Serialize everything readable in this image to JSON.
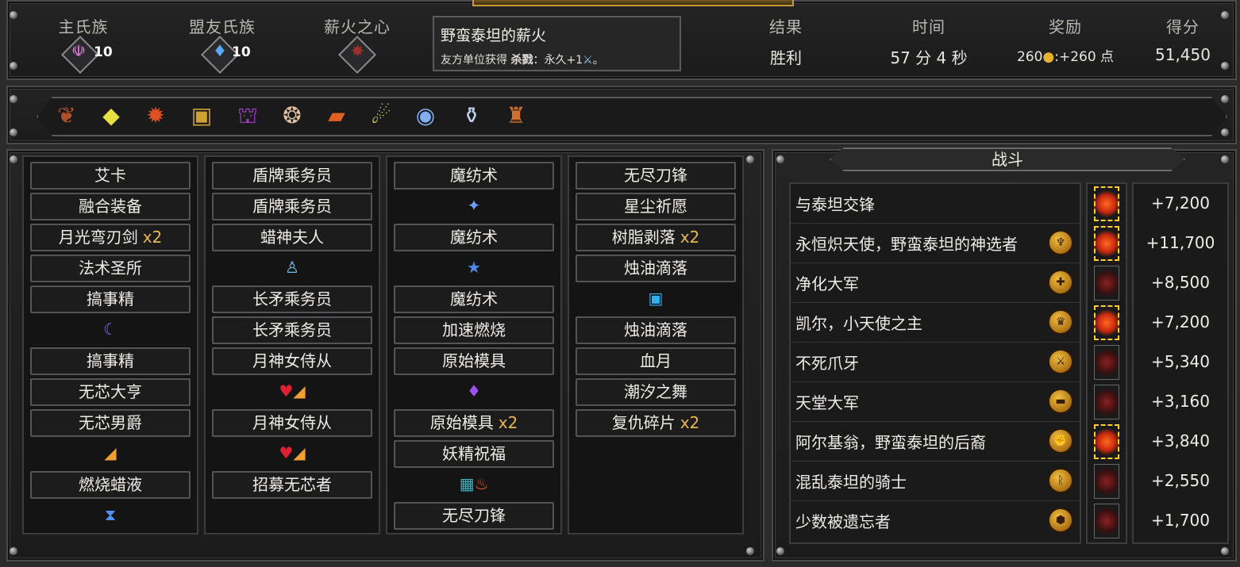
{
  "header": {
    "main_tribe_label": "主氏族",
    "main_tribe_value": "10",
    "ally_tribe_label": "盟友氏族",
    "ally_tribe_value": "10",
    "fire_heart_label": "薪火之心",
    "fire_title": "野蛮泰坦的薪火",
    "fire_desc_prefix": "友方单位获得",
    "fire_desc_keyword": "杀戮",
    "fire_desc_suffix": "：永久+1",
    "fire_desc_end": "。",
    "result_label": "结果",
    "result_value": "胜利",
    "time_label": "时间",
    "time_value": "57 分 4 秒",
    "reward_label": "奖励",
    "reward_gold": "260",
    "reward_points": ":+260 点",
    "score_label": "得分",
    "score_value": "51,450"
  },
  "artifacts": [
    "cannon-icon",
    "crystal-icon",
    "fire-spirit-icon",
    "golden-card-icon",
    "purple-table-icon",
    "dancer-icon",
    "fire-card-icon",
    "larva-icon",
    "frost-orb-icon",
    "vial-icon",
    "totem-icon"
  ],
  "deck": {
    "col1": [
      "艾卡",
      "融合装备",
      "月光弯刃剑",
      "法术圣所",
      "搞事精",
      "",
      "搞事精",
      "无芯大亨",
      "无芯男爵",
      "",
      "燃烧蜡液",
      ""
    ],
    "col1_x2": [
      false,
      false,
      true,
      false,
      false,
      false,
      false,
      false,
      false,
      false,
      false,
      false
    ],
    "col2": [
      "盾牌乘务员",
      "盾牌乘务员",
      "蜡神夫人",
      "",
      "长矛乘务员",
      "长矛乘务员",
      "月神女侍从",
      "",
      "月神女侍从",
      "",
      "招募无芯者"
    ],
    "col3": [
      "魔纺术",
      "",
      "魔纺术",
      "",
      "魔纺术",
      "加速燃烧",
      "原始模具",
      "",
      "原始模具",
      "妖精祝福",
      "",
      "无尽刀锋"
    ],
    "col4": [
      "无尽刀锋",
      "星尘祈愿",
      "树脂剥落",
      "烛油滴落",
      "",
      "烛油滴落",
      "血月",
      "潮汐之舞",
      "复仇碎片"
    ],
    "x2_label": "x2"
  },
  "battle": {
    "title": "战斗",
    "rows": [
      {
        "name": "与泰坦交锋",
        "badge": "",
        "result": "win",
        "score": "+7,200"
      },
      {
        "name": "永恒炽天使，野蛮泰坦的神选者",
        "badge": "angel-icon",
        "result": "win",
        "score": "+11,700"
      },
      {
        "name": "净化大军",
        "badge": "cross-icon",
        "result": "lose",
        "score": "+8,500"
      },
      {
        "name": "凯尔，小天使之主",
        "badge": "helmet-icon",
        "result": "win",
        "score": "+7,200"
      },
      {
        "name": "不死爪牙",
        "badge": "claw-icon",
        "result": "lose",
        "score": "+5,340"
      },
      {
        "name": "天堂大军",
        "badge": "tablet-icon",
        "result": "lose",
        "score": "+3,160"
      },
      {
        "name": "阿尔基翁，野蛮泰坦的后裔",
        "badge": "fist-icon",
        "result": "win",
        "score": "+3,840"
      },
      {
        "name": "混乱泰坦的骑士",
        "badge": "rune-icon",
        "result": "lose",
        "score": "+2,550"
      },
      {
        "name": "少数被遗忘者",
        "badge": "hive-icon",
        "result": "lose",
        "score": "+1,700"
      }
    ]
  }
}
